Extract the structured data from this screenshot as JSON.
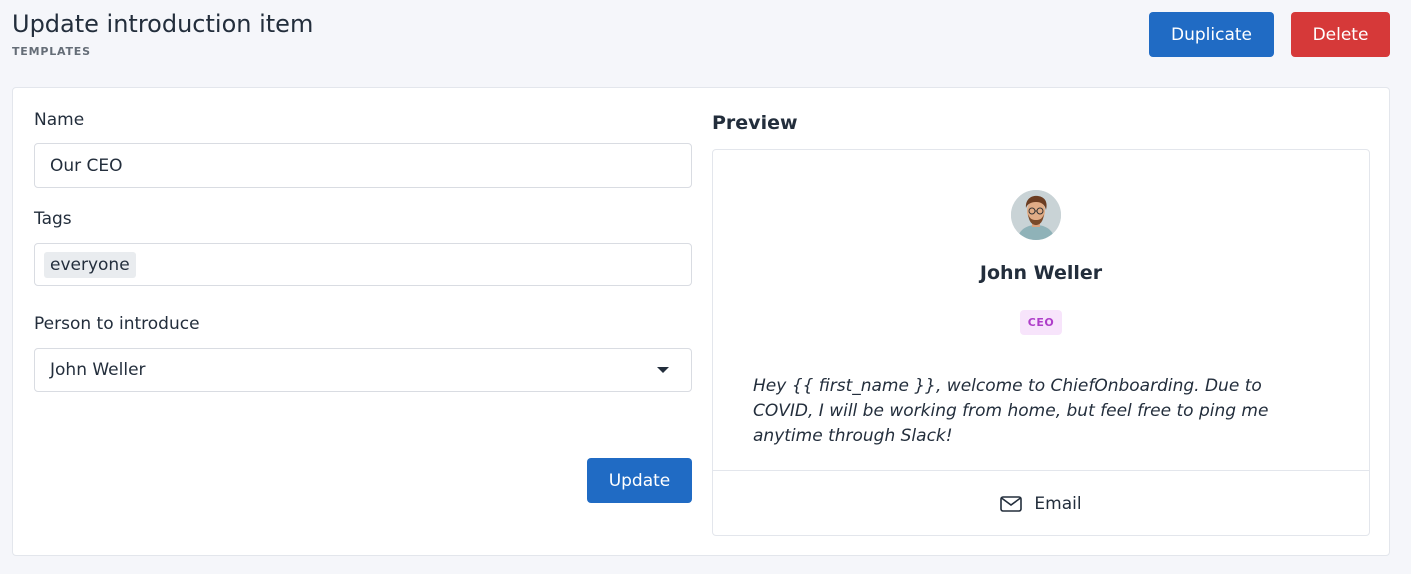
{
  "header": {
    "title": "Update introduction item",
    "pretitle": "TEMPLATES",
    "duplicate_label": "Duplicate",
    "delete_label": "Delete"
  },
  "form": {
    "name_label": "Name",
    "name_value": "Our CEO",
    "tags_label": "Tags",
    "tags": [
      "everyone"
    ],
    "person_label": "Person to introduce",
    "person_value": "John Weller",
    "update_label": "Update"
  },
  "preview": {
    "title": "Preview",
    "person_name": "John Weller",
    "role_badge": "CEO",
    "message": "Hey {{ first_name }}, welcome to ChiefOnboarding. Due to COVID, I will be working from home, but feel free to ping me anytime through Slack!",
    "email_label": "Email",
    "email_icon": "mail-icon",
    "avatar_icon": "avatar-photo"
  },
  "colors": {
    "primary": "#206bc4",
    "danger": "#d63939",
    "badge_bg": "#f7e4fb",
    "badge_text": "#ae3ec9"
  }
}
